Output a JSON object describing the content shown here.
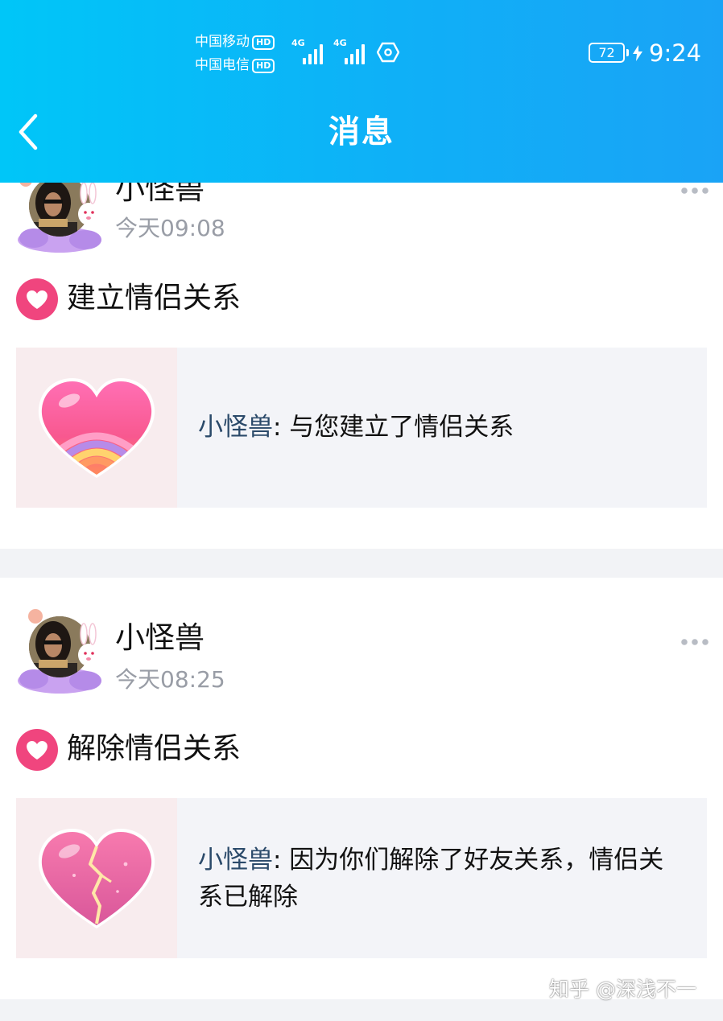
{
  "status_bar": {
    "carrier_1": "中国移动",
    "carrier_2": "中国电信",
    "hd_badge": "HD",
    "network": "4G",
    "battery": "72",
    "time": "9:24"
  },
  "nav": {
    "title": "消息"
  },
  "messages": [
    {
      "user": "小怪兽",
      "time": "今天09:08",
      "event": "建立情侣关系",
      "card_user": "小怪兽",
      "card_message": ": 与您建立了情侣关系"
    },
    {
      "user": "小怪兽",
      "time": "今天08:25",
      "event": "解除情侣关系",
      "card_user": "小怪兽",
      "card_message": ": 因为你们解除了好友关系，情侣关系已解除"
    }
  ],
  "watermark": "知乎 @深浅不一",
  "colors": {
    "header_gradient_start": "#00c6f8",
    "header_gradient_end": "#1aa3f6",
    "accent_pink": "#f0457e",
    "card_background": "#f3f4f8",
    "time_text": "#999da6",
    "card_user_text": "#2b4a6a"
  },
  "icons": {
    "back": "chevron-left-icon",
    "more": "more-dots-icon",
    "event": "heart-badge-icon",
    "card_1": "rainbow-heart-icon",
    "card_2": "broken-heart-icon"
  }
}
